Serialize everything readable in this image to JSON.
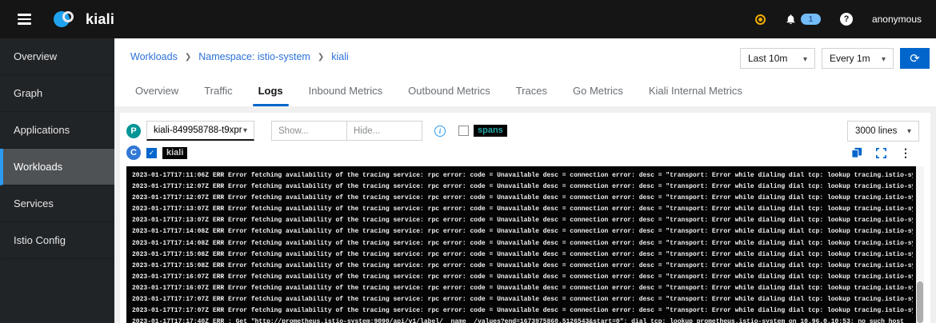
{
  "masthead": {
    "brand": "kiali",
    "notifications": {
      "count": "1"
    },
    "user": "anonymous"
  },
  "sidebar": {
    "items": [
      {
        "label": "Overview",
        "active": false
      },
      {
        "label": "Graph",
        "active": false
      },
      {
        "label": "Applications",
        "active": false
      },
      {
        "label": "Workloads",
        "active": true
      },
      {
        "label": "Services",
        "active": false
      },
      {
        "label": "Istio Config",
        "active": false
      }
    ]
  },
  "breadcrumb": {
    "items": [
      {
        "label": "Workloads"
      },
      {
        "label": "Namespace: istio-system"
      },
      {
        "label": "kiali"
      }
    ]
  },
  "time_toolbar": {
    "duration": "Last 10m",
    "interval": "Every 1m"
  },
  "tabs": {
    "items": [
      {
        "label": "Overview",
        "active": false
      },
      {
        "label": "Traffic",
        "active": false
      },
      {
        "label": "Logs",
        "active": true
      },
      {
        "label": "Inbound Metrics",
        "active": false
      },
      {
        "label": "Outbound Metrics",
        "active": false
      },
      {
        "label": "Traces",
        "active": false
      },
      {
        "label": "Go Metrics",
        "active": false
      },
      {
        "label": "Kiali Internal Metrics",
        "active": false
      }
    ]
  },
  "log_controls": {
    "pod_badge": "P",
    "pod_name": "kiali-849958788-t9xpr",
    "show_placeholder": "Show...",
    "hide_placeholder": "Hide...",
    "spans_label": "spans",
    "spans_checked": false,
    "lines_selected": "3000 lines",
    "container_badge": "C",
    "container_name": "kiali",
    "container_checked": true
  },
  "log_viewer": {
    "lines": [
      "2023-01-17T17:11:06Z ERR Error fetching availability of the tracing service: rpc error: code = Unavailable desc = connection error: desc = \"transport: Error while dialing dial tcp: lookup tracing.istio-sy",
      "2023-01-17T17:12:07Z ERR Error fetching availability of the tracing service: rpc error: code = Unavailable desc = connection error: desc = \"transport: Error while dialing dial tcp: lookup tracing.istio-sy",
      "2023-01-17T17:12:07Z ERR Error fetching availability of the tracing service: rpc error: code = Unavailable desc = connection error: desc = \"transport: Error while dialing dial tcp: lookup tracing.istio-sy",
      "2023-01-17T17:13:07Z ERR Error fetching availability of the tracing service: rpc error: code = Unavailable desc = connection error: desc = \"transport: Error while dialing dial tcp: lookup tracing.istio-sy",
      "2023-01-17T17:13:07Z ERR Error fetching availability of the tracing service: rpc error: code = Unavailable desc = connection error: desc = \"transport: Error while dialing dial tcp: lookup tracing.istio-sy",
      "2023-01-17T17:14:08Z ERR Error fetching availability of the tracing service: rpc error: code = Unavailable desc = connection error: desc = \"transport: Error while dialing dial tcp: lookup tracing.istio-sy",
      "2023-01-17T17:14:08Z ERR Error fetching availability of the tracing service: rpc error: code = Unavailable desc = connection error: desc = \"transport: Error while dialing dial tcp: lookup tracing.istio-sy",
      "2023-01-17T17:15:08Z ERR Error fetching availability of the tracing service: rpc error: code = Unavailable desc = connection error: desc = \"transport: Error while dialing dial tcp: lookup tracing.istio-sy",
      "2023-01-17T17:15:08Z ERR Error fetching availability of the tracing service: rpc error: code = Unavailable desc = connection error: desc = \"transport: Error while dialing dial tcp: lookup tracing.istio-sy",
      "2023-01-17T17:16:07Z ERR Error fetching availability of the tracing service: rpc error: code = Unavailable desc = connection error: desc = \"transport: Error while dialing dial tcp: lookup tracing.istio-sy",
      "2023-01-17T17:16:07Z ERR Error fetching availability of the tracing service: rpc error: code = Unavailable desc = connection error: desc = \"transport: Error while dialing dial tcp: lookup tracing.istio-sy",
      "2023-01-17T17:17:07Z ERR Error fetching availability of the tracing service: rpc error: code = Unavailable desc = connection error: desc = \"transport: Error while dialing dial tcp: lookup tracing.istio-sy",
      "2023-01-17T17:17:07Z ERR Error fetching availability of the tracing service: rpc error: code = Unavailable desc = connection error: desc = \"transport: Error while dialing dial tcp: lookup tracing.istio-sy",
      "2023-01-17T17:17:40Z ERR : Get \"http://prometheus.istio-system:9090/api/v1/label/__name__/values?end=1673975860.5126543&start=0\": dial tcp: lookup prometheus.istio-system on 10.96.0.10:53: no such host"
    ]
  },
  "icons": {
    "hamburger": "menu bars",
    "status_dot": "amber ring dot",
    "bell": "notification bell",
    "help": "?",
    "refresh": "⟳",
    "info": "i in circle",
    "copy": "overlapping squares",
    "expand": "corner brackets",
    "kebab": "⋮",
    "caret_down": "▾"
  },
  "colors": {
    "masthead_bg": "#151515",
    "sidebar_bg": "#212427",
    "sidebar_active_bg": "#4f5255",
    "sidebar_active_border": "#2b9af3",
    "link_blue": "#2b71d8",
    "accent_blue": "#0066cc",
    "badge_p_teal": "#009596",
    "badge_c_blue": "#3178d6",
    "spans_teal": "#26a5a5",
    "warning_amber": "#f0ab00",
    "notif_badge_blue": "#73bcf7",
    "log_bg": "#050505",
    "page_bg": "#f0f0f0"
  }
}
